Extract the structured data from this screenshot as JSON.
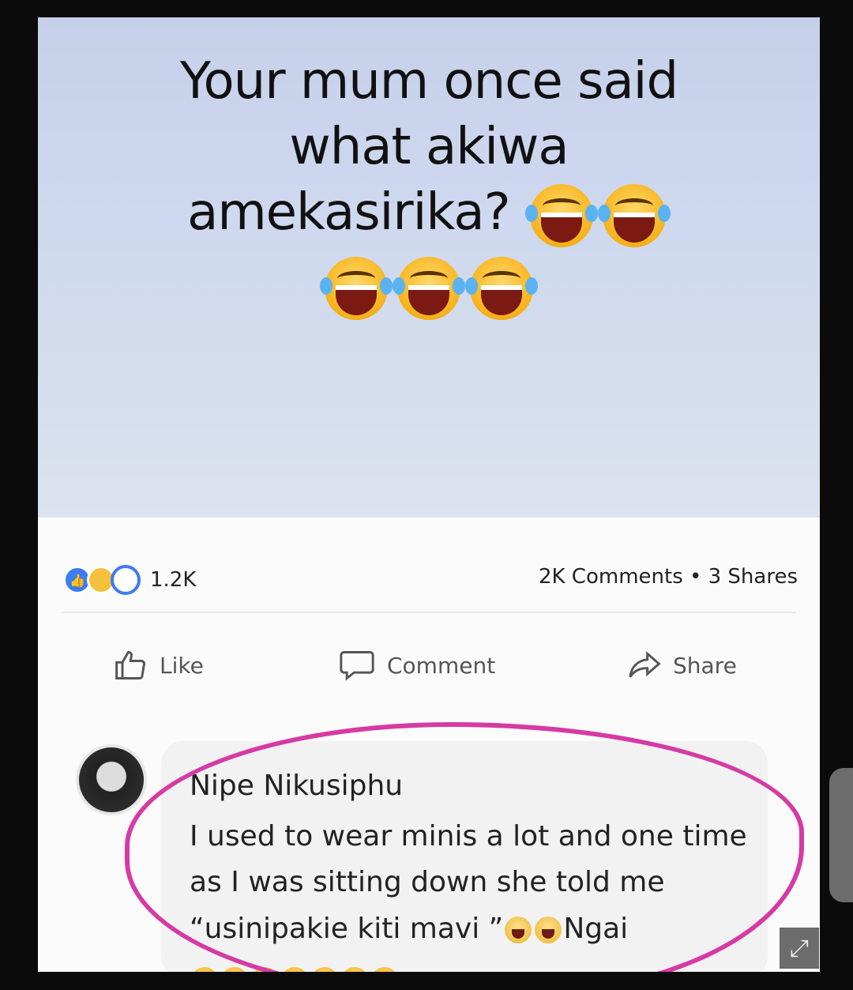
{
  "post": {
    "text_line1": "Your mum once said",
    "text_line2": "what akiwa",
    "text_line3": "amekasirika?",
    "reactions_count": "1.2K",
    "comments_shares": "2K Comments • 3 Shares",
    "emoji_name": "face-with-tears-of-joy"
  },
  "actions": {
    "like": "Like",
    "comment": "Comment",
    "share": "Share"
  },
  "comment": {
    "author": "Nipe  Nikusiphu",
    "body": "I used  to wear minis a lot and one time as I was sitting down she told me “usinipakie kiti mavi ”",
    "suffix": "Ngai"
  },
  "colors": {
    "highlight_circle": "#d63aa4",
    "like_blue": "#3b7cf0"
  }
}
